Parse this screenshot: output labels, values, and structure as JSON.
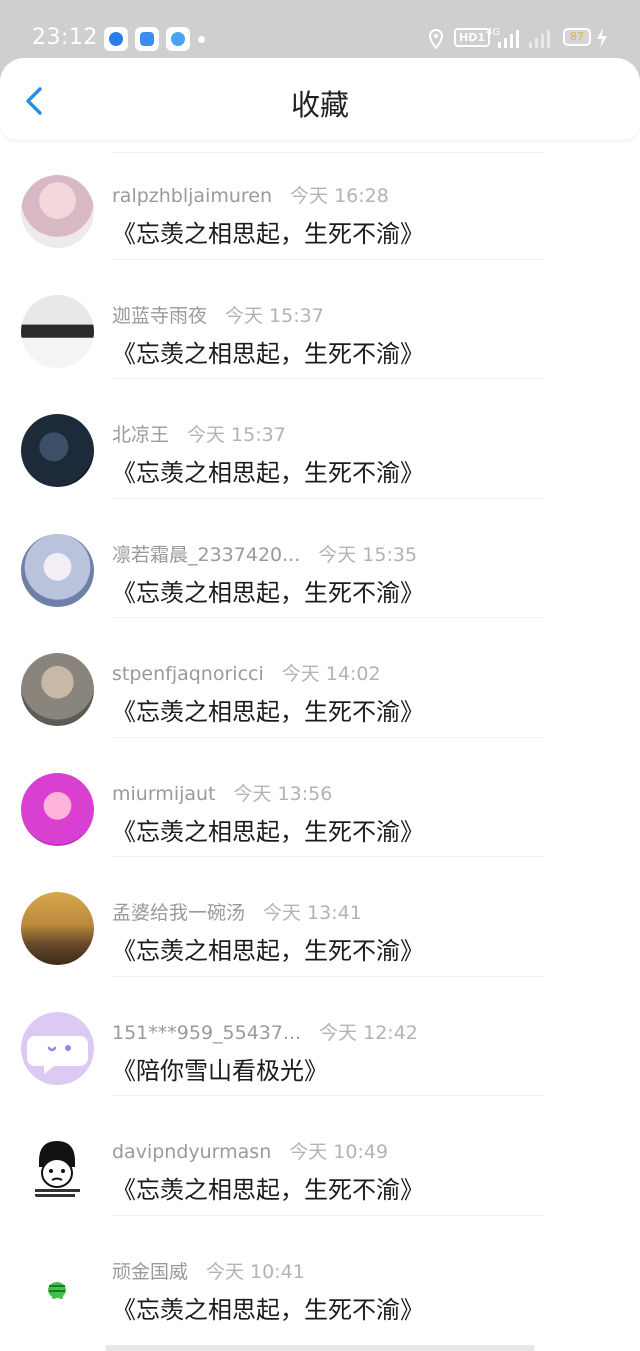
{
  "status": {
    "time": "23:12",
    "hd": "HD1",
    "network": "4G",
    "battery": "87"
  },
  "header": {
    "title": "收藏"
  },
  "items": [
    {
      "name": "ralpzhbljaimuren",
      "time": "今天 16:28",
      "content": "《忘羡之相思起，生死不渝》",
      "avatar_color": "#d8b8c4"
    },
    {
      "name": "迦蓝寺雨夜",
      "time": "今天 15:37",
      "content": "《忘羡之相思起，生死不渝》",
      "avatar_color": "#c8c8c8"
    },
    {
      "name": "北凉王",
      "time": "今天 15:37",
      "content": "《忘羡之相思起，生死不渝》",
      "avatar_color": "#1c2a3a"
    },
    {
      "name": "凛若霜晨_2337420...",
      "time": "今天 15:35",
      "content": "《忘羡之相思起，生死不渝》",
      "avatar_color": "#b9c4dc"
    },
    {
      "name": "stpenfjaqnoricci",
      "time": "今天 14:02",
      "content": "《忘羡之相思起，生死不渝》",
      "avatar_color": "#8a857c"
    },
    {
      "name": "miurmijaut",
      "time": "今天 13:56",
      "content": "《忘羡之相思起，生死不渝》",
      "avatar_color": "#d93fd0"
    },
    {
      "name": "孟婆给我一碗汤",
      "time": "今天 13:41",
      "content": "《忘羡之相思起，生死不渝》",
      "avatar_color": "#b98a3c"
    },
    {
      "name": "151***959_55437...",
      "time": "今天 12:42",
      "content": "《陪你雪山看极光》",
      "avatar_color": "#dccaf5"
    },
    {
      "name": "davipndyurmasn",
      "time": "今天 10:49",
      "content": "《忘羡之相思起，生死不渝》",
      "avatar_color": "#ffffff"
    },
    {
      "name": "顽金国威",
      "time": "今天 10:41",
      "content": "《忘羡之相思起，生死不渝》",
      "avatar_color": "#ffffff"
    }
  ]
}
